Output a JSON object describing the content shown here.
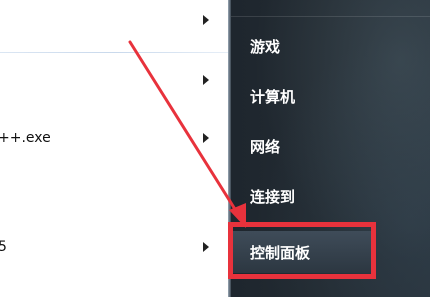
{
  "left_menu": {
    "items": [
      {
        "label": "",
        "has_arrow": true
      },
      {
        "label": "",
        "has_arrow": true
      },
      {
        "label": "++.exe",
        "has_arrow": true
      },
      {
        "label": "5",
        "has_arrow": true
      }
    ]
  },
  "right_menu": {
    "items": [
      {
        "label": "游戏"
      },
      {
        "label": "计算机"
      },
      {
        "label": "网络"
      },
      {
        "label": "连接到"
      },
      {
        "label": "控制面板"
      }
    ]
  },
  "annotation": {
    "highlight_color": "#e8323c",
    "highlighted_item": "控制面板"
  }
}
